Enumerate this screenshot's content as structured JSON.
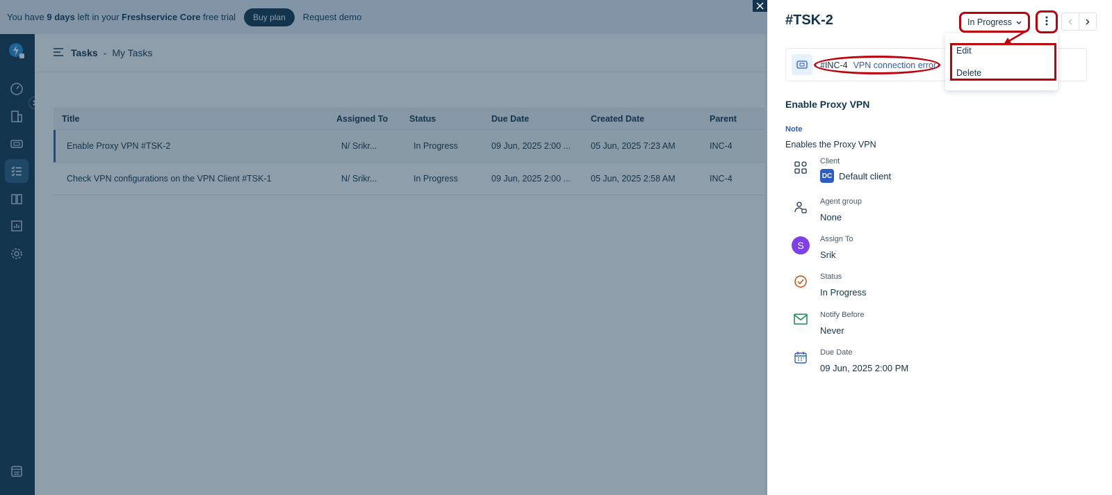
{
  "banner": {
    "prefix": "You have ",
    "days": "9 days",
    "middle": " left in your ",
    "product": "Freshservice Core",
    "suffix": " free trial",
    "buy_label": "Buy plan",
    "demo_label": "Request demo"
  },
  "header": {
    "section": "Tasks",
    "separator": "-",
    "view": "My Tasks"
  },
  "table": {
    "columns": [
      "Title",
      "Assigned To",
      "Status",
      "Due Date",
      "Created Date",
      "Parent"
    ],
    "rows": [
      {
        "title": "Enable Proxy VPN  #TSK-2",
        "assigned": "N/ Srikr...",
        "status": "In Progress",
        "due": "09 Jun, 2025 2:00 ...",
        "created": "05 Jun, 2025 7:23 AM",
        "parent": "INC-4"
      },
      {
        "title": "Check VPN configurations on the VPN Client  #TSK-1",
        "assigned": "N/ Srikr...",
        "status": "In Progress",
        "due": "09 Jun, 2025 2:00 ...",
        "created": "05 Jun, 2025 2:58 AM",
        "parent": "INC-4"
      }
    ]
  },
  "panel": {
    "task_id": "#TSK-2",
    "status_label": "In Progress",
    "parent_id": "#INC-4",
    "parent_title": "VPN connection error",
    "menu": {
      "edit": "Edit",
      "delete": "Delete"
    },
    "title": "Enable Proxy VPN",
    "note_label": "Note",
    "note_text": "Enables the Proxy VPN",
    "props": {
      "client": {
        "label": "Client",
        "badge": "DC",
        "value": "Default client"
      },
      "agent_group": {
        "label": "Agent group",
        "value": "None"
      },
      "assign_to": {
        "label": "Assign To",
        "avatar": "S",
        "value": "Srik"
      },
      "status": {
        "label": "Status",
        "value": "In Progress"
      },
      "notify_before": {
        "label": "Notify Before",
        "value": "Never"
      },
      "due_date": {
        "label": "Due Date",
        "value": "09 Jun, 2025 2:00 PM"
      }
    }
  },
  "colors": {
    "annotation": "#c0000c",
    "link": "#2c5cc5",
    "sidebar": "#12344d"
  }
}
